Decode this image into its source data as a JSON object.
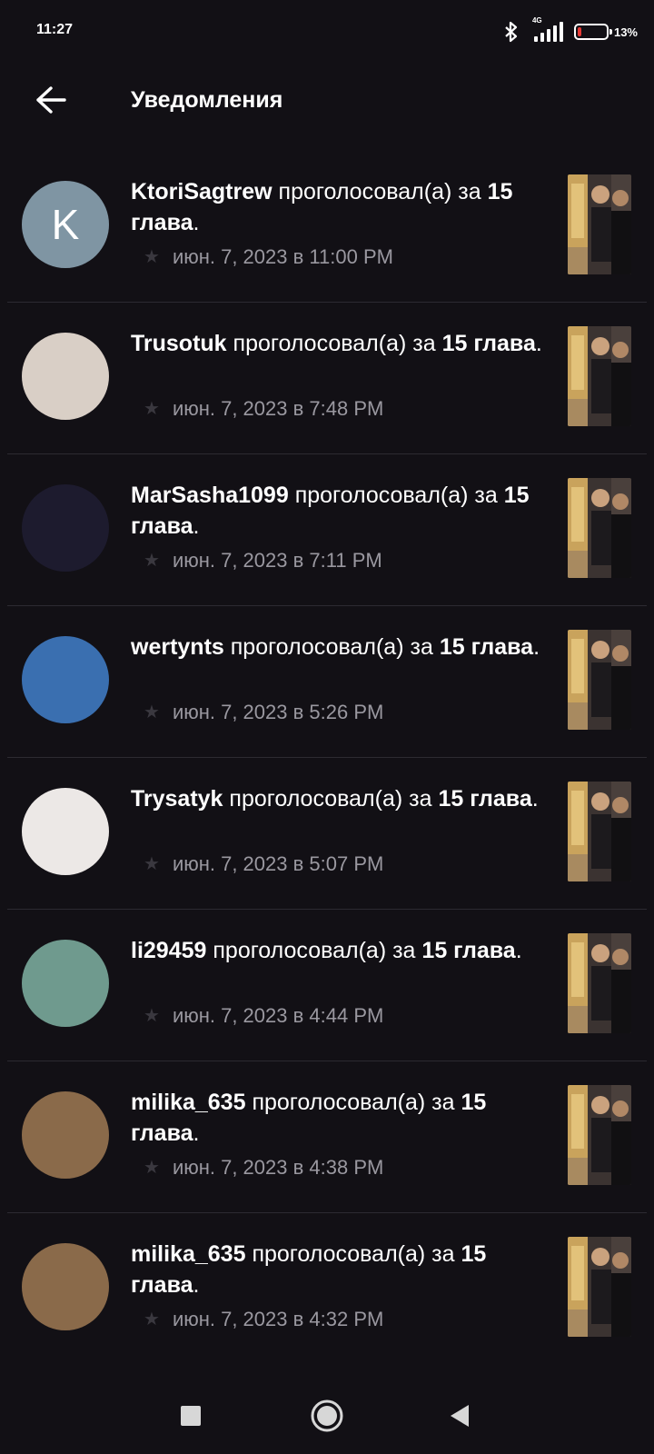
{
  "status_bar": {
    "time": "11:27",
    "network_tag": "4G",
    "battery_percent": 13,
    "battery_label": "13%",
    "battery_color": "#e53935",
    "icons": [
      "bluetooth-icon",
      "signal-icon",
      "battery-icon"
    ]
  },
  "header": {
    "back_icon": "arrow-left-icon",
    "title": "Уведомления"
  },
  "notifications": [
    {
      "user": "KtoriSagtrew",
      "action": "проголосовал(а) за",
      "target": "15 глава",
      "time": "июн. 7, 2023 в 11:00 PM",
      "avatar_letter": "K",
      "avatar_color": "#7f95a3"
    },
    {
      "user": "Trusotuk",
      "action": "проголосовал(а) за",
      "target": "15 глава",
      "time": "июн. 7, 2023 в 7:48 PM",
      "avatar_letter": "",
      "avatar_color": "#d9cfc6"
    },
    {
      "user": "MarSasha1099",
      "action": "проголосовал(а) за",
      "target": "15 глава",
      "time": "июн. 7, 2023 в 7:11 PM",
      "avatar_letter": "",
      "avatar_color": "#1d1b2e"
    },
    {
      "user": "wertynts",
      "action": "проголосовал(а) за",
      "target": "15 глава",
      "time": "июн. 7, 2023 в 5:26 PM",
      "avatar_letter": "",
      "avatar_color": "#3a6fb0"
    },
    {
      "user": "Trysatyk",
      "action": "проголосовал(а) за",
      "target": "15 глава",
      "time": "июн. 7, 2023 в 5:07 PM",
      "avatar_letter": "",
      "avatar_color": "#ece8e6"
    },
    {
      "user": "li29459",
      "action": "проголосовал(а) за",
      "target": "15 глава",
      "time": "июн. 7, 2023 в 4:44 PM",
      "avatar_letter": "",
      "avatar_color": "#6f9a8e"
    },
    {
      "user": "milika_635",
      "action": "проголосовал(а) за",
      "target": "15 глава",
      "time": "июн. 7, 2023 в 4:38 PM",
      "avatar_letter": "",
      "avatar_color": "#8a6a4a"
    },
    {
      "user": "milika_635",
      "action": "проголосовал(а) за",
      "target": "15 глава",
      "time": "июн. 7, 2023 в 4:32 PM",
      "avatar_letter": "",
      "avatar_color": "#8a6a4a"
    }
  ],
  "nav_bar": {
    "recents_icon": "square-icon",
    "home_icon": "circle-icon",
    "back_icon": "triangle-back-icon"
  }
}
